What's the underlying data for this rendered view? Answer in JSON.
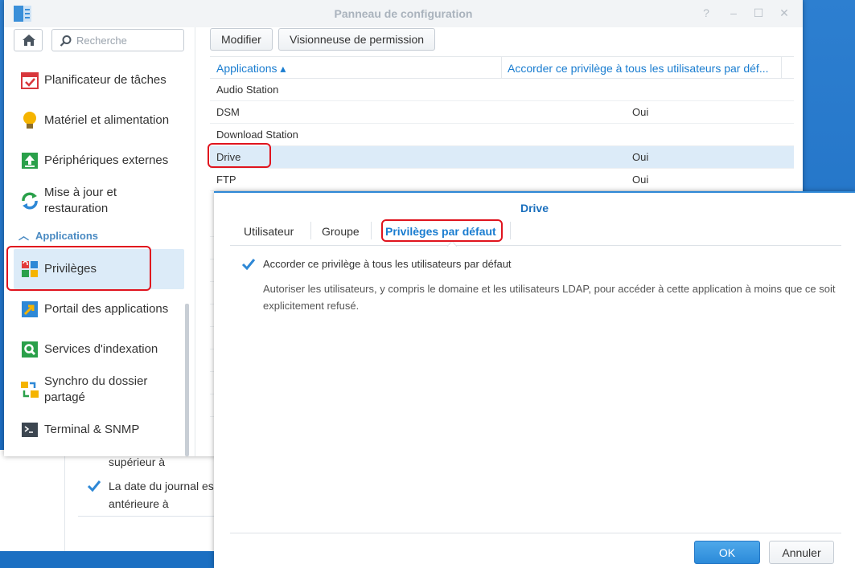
{
  "window": {
    "title": "Panneau de configuration",
    "controls": [
      "?",
      "–",
      "☐",
      "✕"
    ]
  },
  "sidebar": {
    "search_placeholder": "Recherche",
    "section_label": "Applications",
    "items": [
      {
        "label": "Planificateur de tâches",
        "icon": "task-scheduler-icon"
      },
      {
        "label": "Matériel et alimentation",
        "icon": "lightbulb-icon"
      },
      {
        "label": "Périphériques externes",
        "icon": "external-device-icon"
      },
      {
        "label": "Mise à jour et restauration",
        "icon": "update-restore-icon"
      },
      {
        "label": "Privilèges",
        "icon": "privileges-icon"
      },
      {
        "label": "Portail des applications",
        "icon": "app-portal-icon"
      },
      {
        "label": "Services d'indexation",
        "icon": "indexing-icon"
      },
      {
        "label": "Synchro du dossier partagé",
        "icon": "shared-folder-sync-icon"
      },
      {
        "label": "Terminal & SNMP",
        "icon": "terminal-icon"
      }
    ]
  },
  "toolbar": {
    "edit_label": "Modifier",
    "permission_viewer_label": "Visionneuse de permission"
  },
  "grid": {
    "col_app": "Applications ▴",
    "col_default": "Accorder ce privilège à tous les utilisateurs par déf...",
    "rows": [
      {
        "app": "Audio Station",
        "value": ""
      },
      {
        "app": "DSM",
        "value": "Oui"
      },
      {
        "app": "Download Station",
        "value": ""
      },
      {
        "app": "Drive",
        "value": "Oui"
      },
      {
        "app": "FTP",
        "value": "Oui"
      }
    ]
  },
  "background_window": {
    "line1": "supérieur à",
    "line2": "La date du journal es",
    "line3": "antérieure à"
  },
  "dialog": {
    "title": "Drive",
    "tabs": [
      "Utilisateur",
      "Groupe",
      "Privilèges par défaut"
    ],
    "checkbox_label": "Accorder ce privilège à tous les utilisateurs par défaut",
    "description": "Autoriser les utilisateurs, y compris le domaine et les utilisateurs LDAP, pour accéder à cette application à moins que ce soit explicitement refusé.",
    "ok_label": "OK",
    "cancel_label": "Annuler"
  },
  "colors": {
    "accent": "#1a7dd0",
    "highlight": "#e0141e",
    "selected_row": "#dcebf8"
  }
}
